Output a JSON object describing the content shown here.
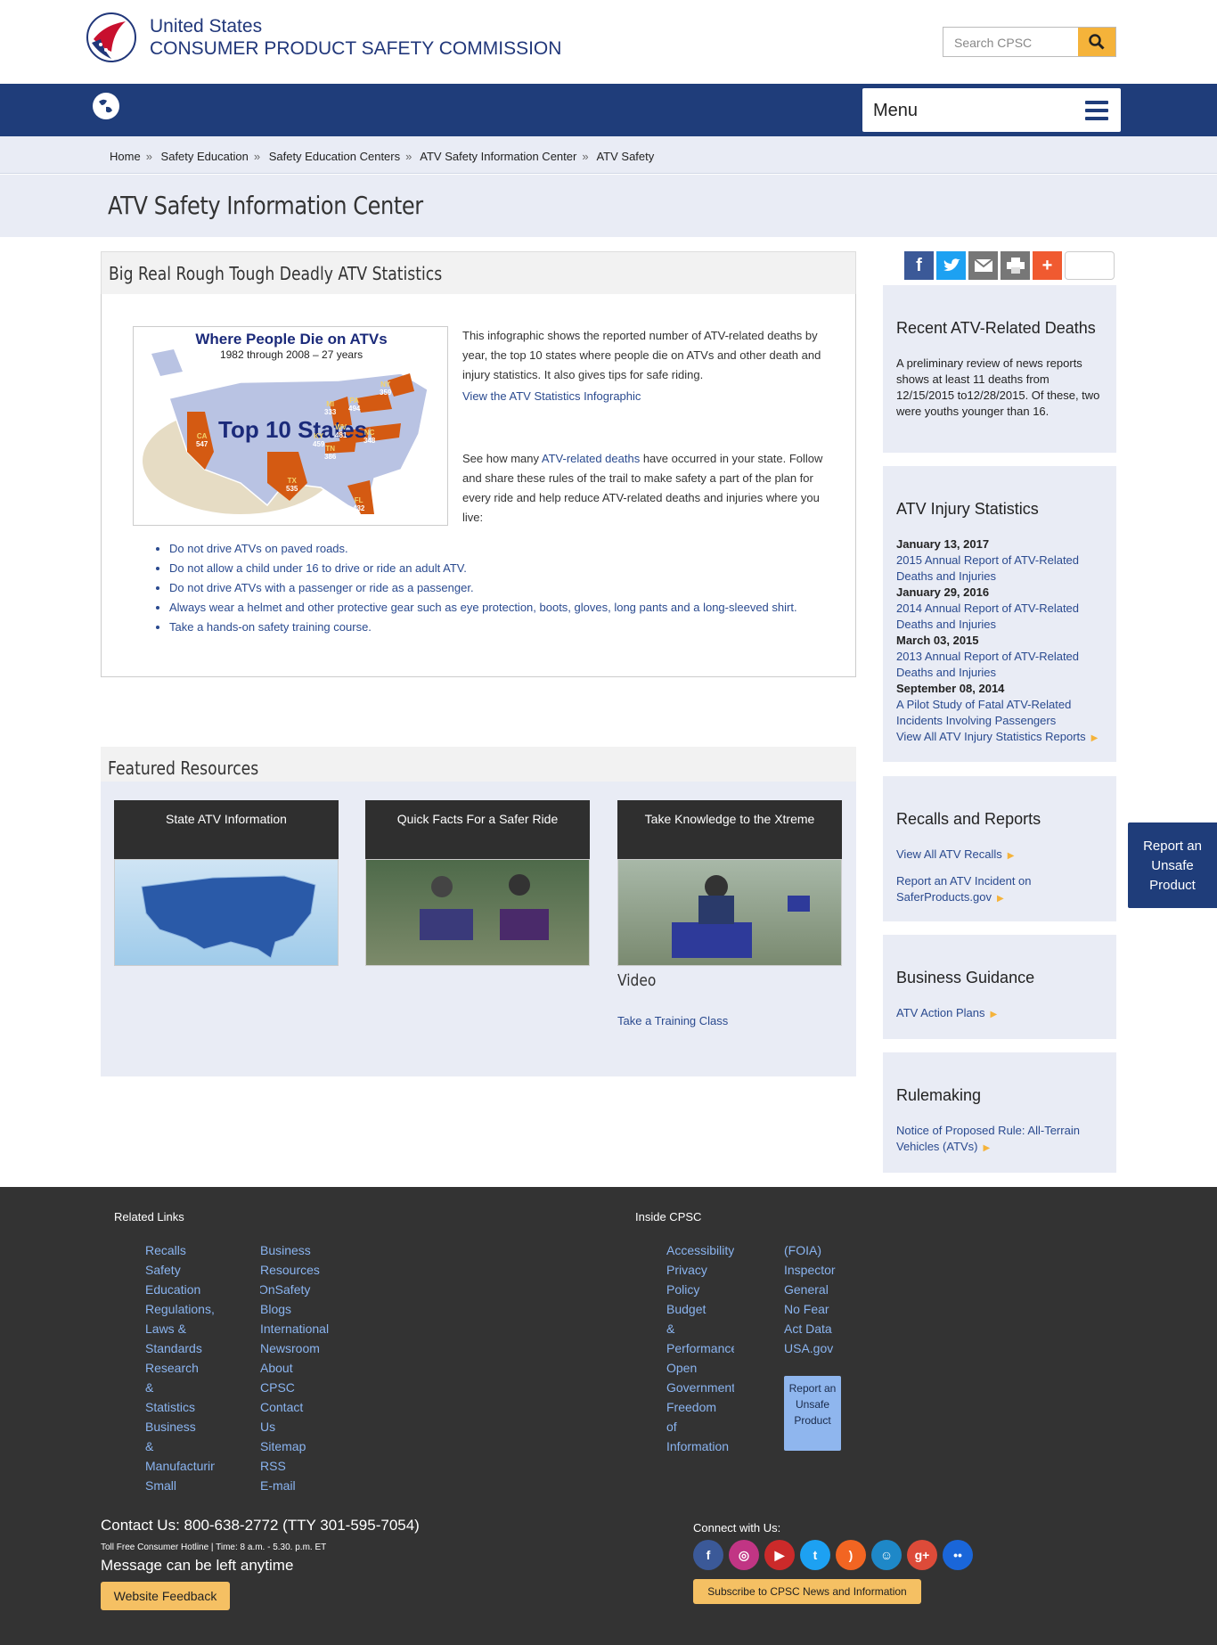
{
  "header": {
    "org_line1": "United States",
    "org_line2": "CONSUMER PRODUCT SAFETY COMMISSION",
    "search_placeholder": "Search CPSC",
    "menu_label": "Menu"
  },
  "breadcrumb": [
    "Home",
    "Safety Education",
    "Safety Education Centers",
    "ATV Safety Information Center",
    "ATV Safety"
  ],
  "page_title": "ATV Safety Information Center",
  "stats_box": {
    "title": "Big Real Rough Tough Deadly ATV Statistics",
    "map_title": "Where People Die on ATVs",
    "map_subtitle": "1982 through 2008 – 27 years",
    "map_label": "Top 10 States",
    "map_states": [
      {
        "s": "CA",
        "n": "547"
      },
      {
        "s": "TX",
        "n": "535"
      },
      {
        "s": "FL",
        "n": "432"
      },
      {
        "s": "WV",
        "n": "481"
      },
      {
        "s": "KY",
        "n": "459"
      },
      {
        "s": "TN",
        "n": "386"
      },
      {
        "s": "NC",
        "n": "348"
      },
      {
        "s": "PA",
        "n": "494"
      },
      {
        "s": "NY",
        "n": "359"
      },
      {
        "s": "MI",
        "n": "333"
      }
    ],
    "intro": "This infographic shows the reported number of ATV-related deaths by year, the top 10 states where people die on ATVs and other death and injury statistics. It also gives tips for safe riding.",
    "infographic_link": "View the ATV Statistics Infographic",
    "see_pre": "See how many ",
    "see_link": "ATV-related deaths",
    "see_post": " have occurred in your state. Follow and share these rules of the trail to make safety a part of the plan for every ride and help reduce ATV-related deaths and injuries where you live:",
    "rules": [
      "Do not drive ATVs on paved roads.",
      "Do not allow a child under 16 to drive or ride an adult ATV.",
      "Do not drive ATVs with a passenger or ride as a passenger.",
      "Always wear a helmet and other protective gear such as eye protection, boots, gloves, long pants and a long-sleeved shirt.",
      "Take a hands-on safety training course."
    ]
  },
  "featured": {
    "title": "Featured Resources",
    "cards": [
      "State ATV Information",
      "Quick Facts For a Safer Ride",
      "Take Knowledge to the Xtreme"
    ],
    "video_label": "Video",
    "training_link": "Take a Training Class"
  },
  "sidebar": {
    "recent_title": "Recent ATV-Related Deaths",
    "recent_text": "A preliminary review of news reports shows at least 11 deaths from 12/15/2015 to12/28/2015. Of these, two were youths younger than 16.",
    "injury_title": "ATV Injury Statistics",
    "injury_items": [
      {
        "date": "January 13, 2017",
        "link": "2015 Annual Report of ATV-Related Deaths and Injuries"
      },
      {
        "date": "January 29, 2016",
        "link": "2014 Annual Report of ATV-Related Deaths and Injuries"
      },
      {
        "date": "March 03, 2015",
        "link": "2013 Annual Report of ATV-Related Deaths and Injuries"
      },
      {
        "date": "September 08, 2014",
        "link": "A Pilot Study of Fatal ATV-Related Incidents Involving Passengers"
      }
    ],
    "injury_all": "View All ATV Injury Statistics Reports",
    "recalls_title": "Recalls and Reports",
    "recalls_link1": "View All ATV Recalls",
    "recalls_link2": "Report an ATV Incident on SaferProducts.gov",
    "business_title": "Business Guidance",
    "business_link": "ATV Action Plans",
    "rule_title": "Rulemaking",
    "rule_link": "Notice of Proposed Rule: All-Terrain Vehicles (ATVs)"
  },
  "report_tab": "Report an Unsafe Product",
  "footer": {
    "related_title": "Related Links",
    "col1": [
      "Recalls",
      "Safety",
      "Education",
      "Regulations,",
      "Laws &",
      "Standards",
      "Research",
      "&",
      "Statistics",
      "Business",
      "&",
      "Manufacturing",
      "Small"
    ],
    "col2": [
      "Business",
      "Resources",
      "OnSafety",
      "Blogs",
      "International",
      "Newsroom",
      "About",
      "CPSC",
      "Contact",
      "Us",
      "Sitemap",
      "RSS",
      "E-mail"
    ],
    "inside_title": "Inside CPSC",
    "col3": [
      "Accessibility",
      "Privacy",
      "Policy",
      "Budget",
      "&",
      "Performance",
      "Open",
      "Government",
      "Freedom",
      "of",
      "Information"
    ],
    "col4": [
      "(FOIA)",
      "Inspector",
      "General",
      "No Fear",
      "Act Data",
      "USA.gov"
    ],
    "report_btn": "Report an Unsafe Product",
    "contact": "Contact Us: 800-638-2772 (TTY 301-595-7054)",
    "hotline": "Toll Free Consumer Hotline | Time: 8 a.m. - 5.30. p.m. ET",
    "message": "Message can be left anytime",
    "feedback": "Website Feedback",
    "connect": "Connect with Us:",
    "subscribe": "Subscribe to CPSC News and Information",
    "social_icons": [
      "facebook-icon",
      "instagram-icon",
      "youtube-icon",
      "twitter-icon",
      "rss-icon",
      "govdelivery-icon",
      "googleplus-icon",
      "flickr-icon"
    ]
  }
}
